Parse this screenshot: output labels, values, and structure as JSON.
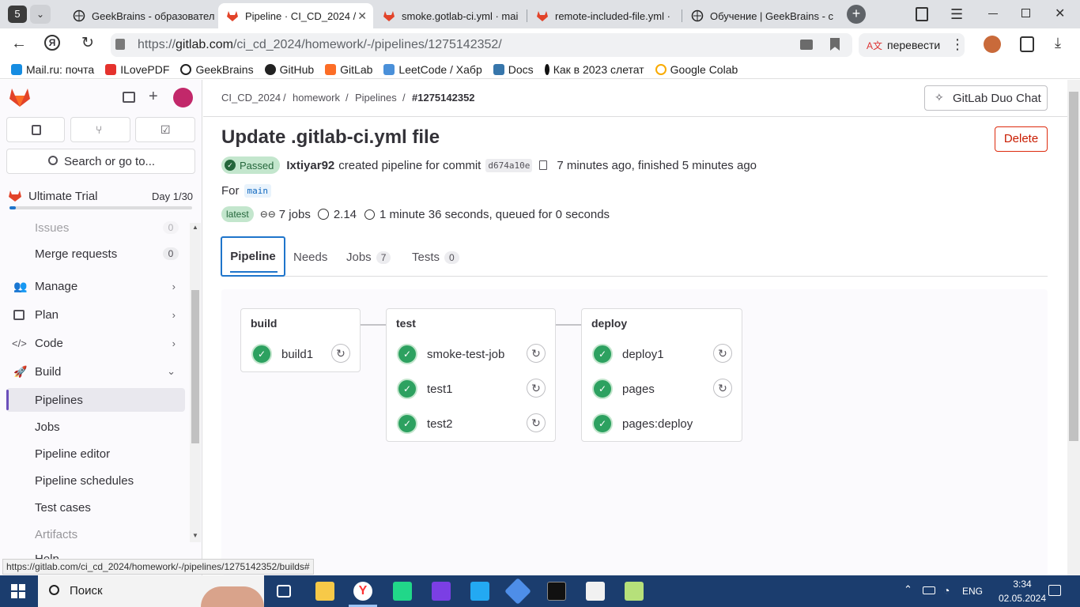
{
  "browser": {
    "tab_count_badge": "5",
    "tabs": [
      {
        "label": "GeekBrains - образовател"
      },
      {
        "label": "Pipeline · CI_CD_2024 /"
      },
      {
        "label": "smoke.gotlab-ci.yml · mai"
      },
      {
        "label": "remote-included-file.yml ·"
      },
      {
        "label": "Обучение | GeekBrains - с"
      }
    ],
    "url_prefix": "https://",
    "url_host": "gitlab.com",
    "url_path": "/ci_cd_2024/homework/-/pipelines/1275142352/",
    "translate_label": "перевести",
    "bookmarks": [
      {
        "label": "Mail.ru: почта",
        "color": "#168de2"
      },
      {
        "label": "ILovePDF",
        "color": "#e5322d"
      },
      {
        "label": "GeekBrains",
        "color": "#222222"
      },
      {
        "label": "GitHub",
        "color": "#222222"
      },
      {
        "label": "GitLab",
        "color": "#fc6d26"
      },
      {
        "label": "LeetCode / Хабр",
        "color": "#4a90d9"
      },
      {
        "label": "Docs",
        "color": "#3776ab"
      },
      {
        "label": "Как в 2023 слетат",
        "color": "#111111"
      },
      {
        "label": "Google Colab",
        "color": "#f9ab00"
      }
    ]
  },
  "sidebar": {
    "search_placeholder": "Search or go to...",
    "trial_label": "Ultimate Trial",
    "trial_day": "Day 1/30",
    "items": [
      {
        "label": "Issues",
        "badge": "0"
      },
      {
        "label": "Merge requests",
        "badge": "0"
      },
      {
        "label": "Manage"
      },
      {
        "label": "Plan"
      },
      {
        "label": "Code"
      },
      {
        "label": "Build"
      },
      {
        "label": "Pipelines"
      },
      {
        "label": "Jobs"
      },
      {
        "label": "Pipeline editor"
      },
      {
        "label": "Pipeline schedules"
      },
      {
        "label": "Test cases"
      },
      {
        "label": "Artifacts"
      },
      {
        "label": "Help"
      }
    ]
  },
  "breadcrumb": [
    "CI_CD_2024",
    "homework",
    "Pipelines",
    "#1275142352"
  ],
  "duo_chat_label": "GitLab Duo Chat",
  "pipeline": {
    "title": "Update .gitlab-ci.yml file",
    "status": "Passed",
    "user": "Ixtiyar92",
    "created_text": "created pipeline for commit",
    "commit": "d674a10e",
    "time_text": "7 minutes ago, finished 5 minutes ago",
    "for_label": "For",
    "branch": "main",
    "latest_label": "latest",
    "jobs_text": "7 jobs",
    "version": "2.14",
    "duration_text": "1 minute 36 seconds, queued for 0 seconds",
    "delete_label": "Delete"
  },
  "tabs": [
    {
      "label": "Pipeline"
    },
    {
      "label": "Needs"
    },
    {
      "label": "Jobs",
      "count": "7"
    },
    {
      "label": "Tests",
      "count": "0"
    }
  ],
  "stages": [
    {
      "name": "build",
      "jobs": [
        {
          "name": "build1"
        }
      ]
    },
    {
      "name": "test",
      "jobs": [
        {
          "name": "smoke-test-job"
        },
        {
          "name": "test1"
        },
        {
          "name": "test2"
        }
      ]
    },
    {
      "name": "deploy",
      "jobs": [
        {
          "name": "deploy1"
        },
        {
          "name": "pages"
        },
        {
          "name": "pages:deploy"
        }
      ]
    }
  ],
  "status_link": "https://gitlab.com/ci_cd_2024/homework/-/pipelines/1275142352/builds#",
  "taskbar": {
    "search_label": "Поиск",
    "lang": "ENG",
    "time": "3:34",
    "date": "02.05.2024"
  }
}
